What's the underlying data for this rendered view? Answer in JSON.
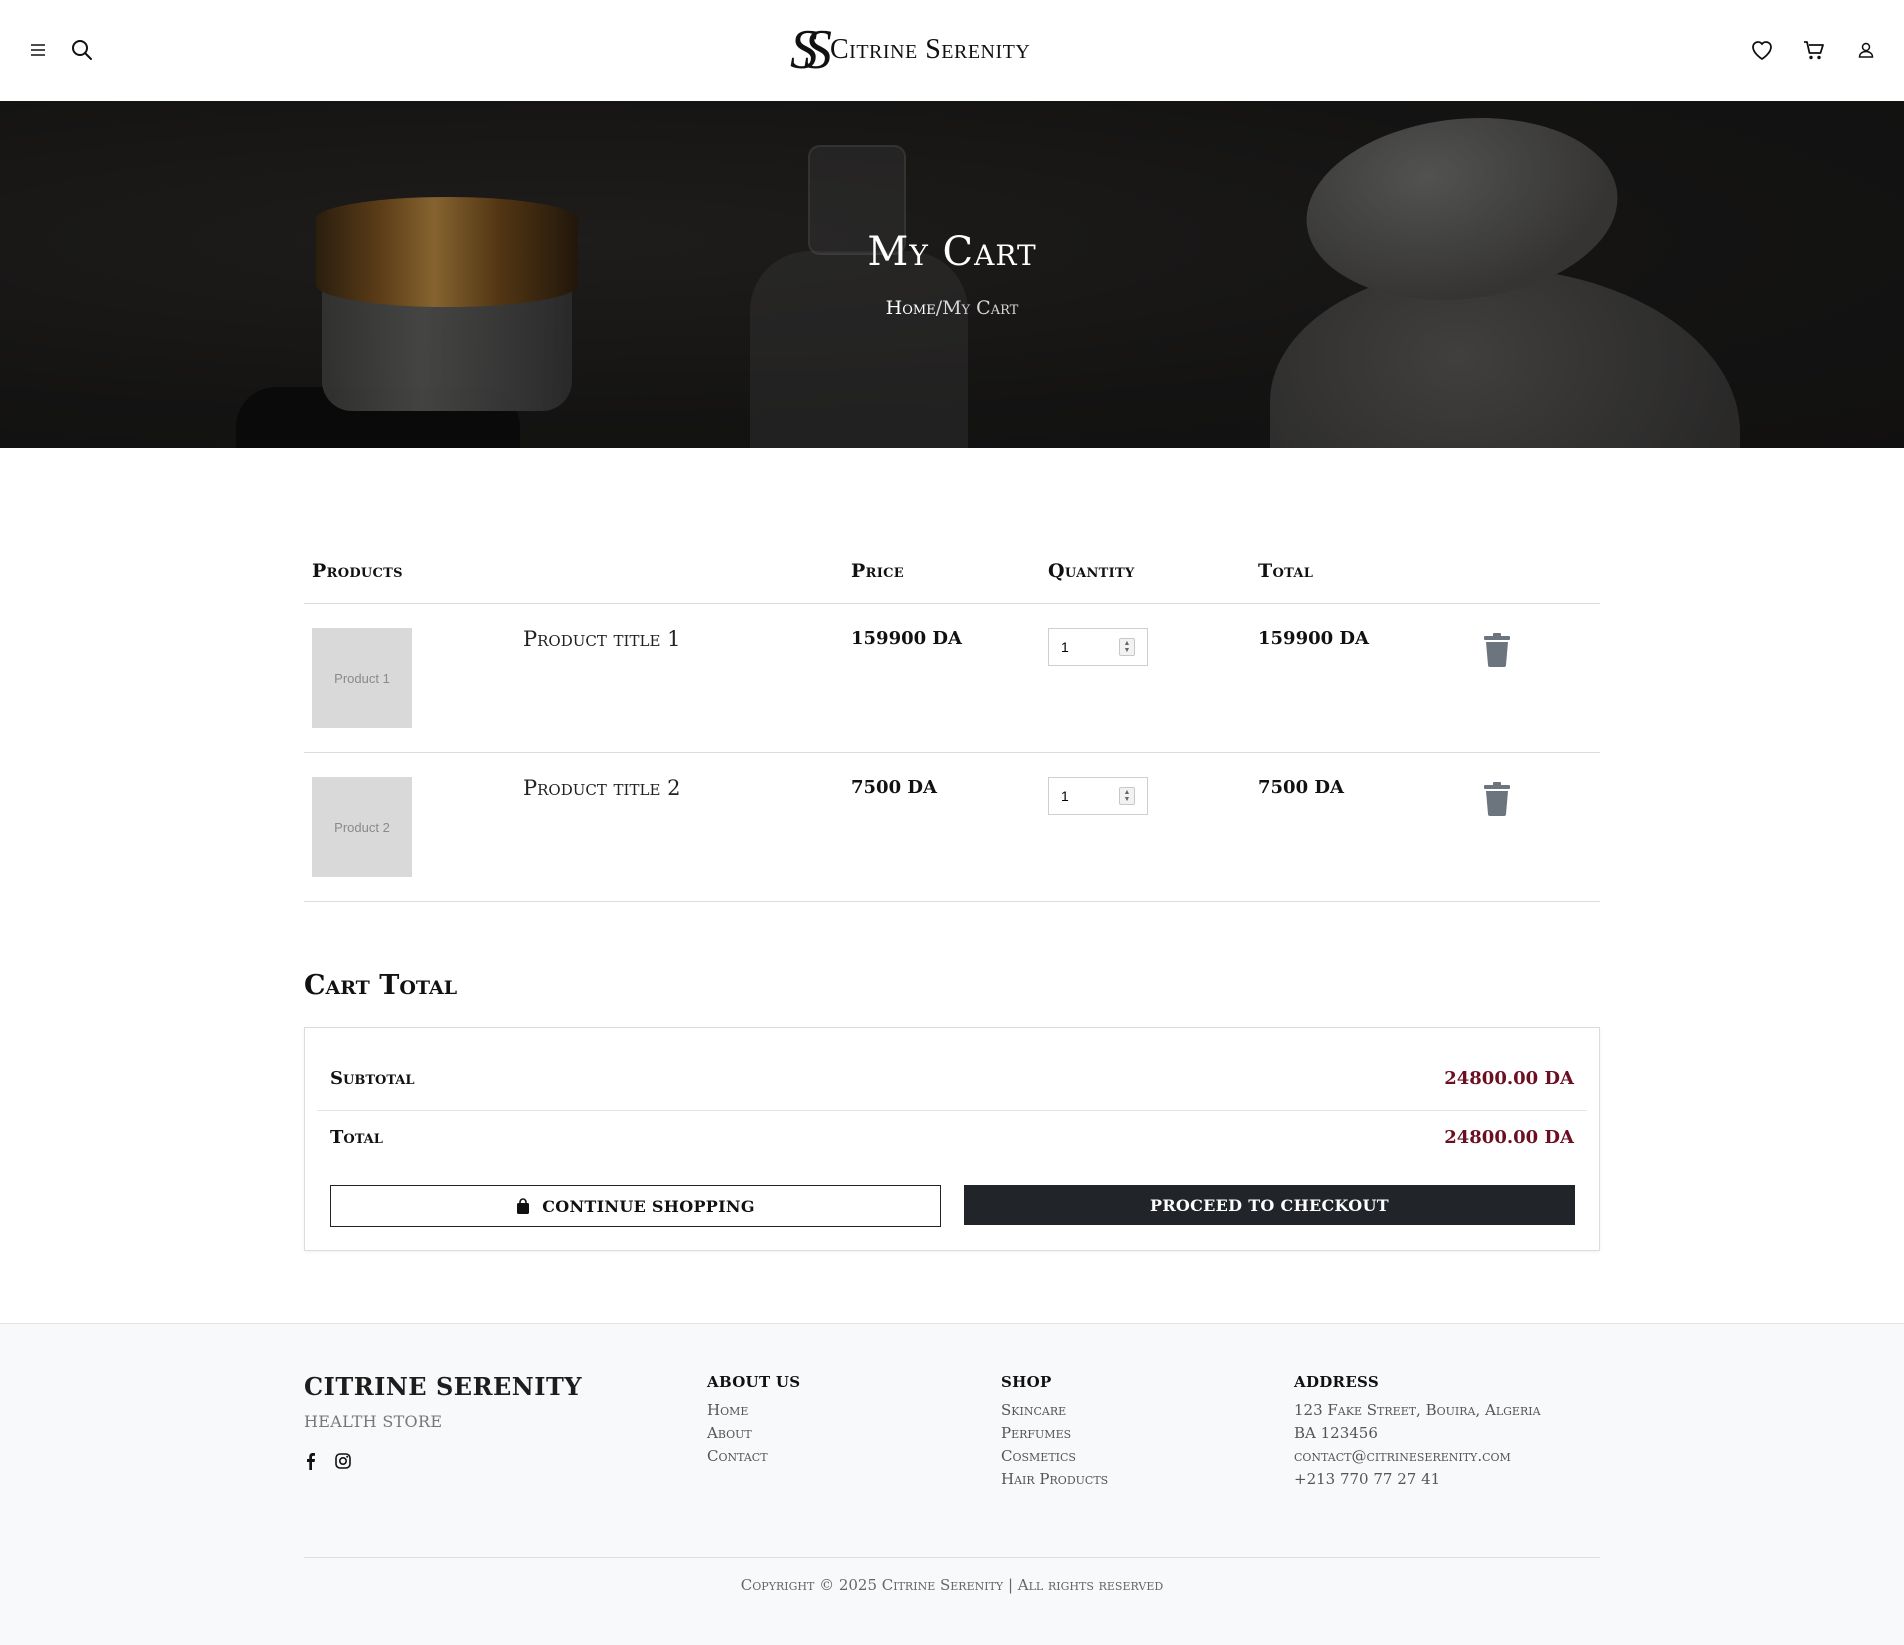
{
  "header": {
    "brand_mark": "SS",
    "brand_name": "Citrine Serenity"
  },
  "hero": {
    "title": "My Cart",
    "breadcrumb": {
      "home": "Home",
      "separator": "/",
      "current": "My Cart"
    }
  },
  "cart": {
    "headers": {
      "products": "Products",
      "price": "Price",
      "quantity": "Quantity",
      "total": "Total"
    },
    "items": [
      {
        "image_label": "Product 1",
        "title": "Product title 1",
        "price": "159900 DA",
        "quantity": "1",
        "total": "159900 DA"
      },
      {
        "image_label": "Product 2",
        "title": "Product title 2",
        "price": "7500 DA",
        "quantity": "1",
        "total": "7500 DA"
      }
    ]
  },
  "cart_total": {
    "title": "Cart Total",
    "subtotal_label": "Subtotal",
    "subtotal_value": "24800.00 DA",
    "total_label": "Total",
    "total_value": "24800.00 DA",
    "continue_label": "CONTINUE SHOPPING",
    "checkout_label": "PROCEED TO CHECKOUT"
  },
  "footer": {
    "brand": "CITRINE SERENITY",
    "tagline": "HEALTH STORE",
    "about": {
      "heading": "ABOUT US",
      "links": [
        "Home",
        "About",
        "Contact"
      ]
    },
    "shop": {
      "heading": "SHOP",
      "links": [
        "Skincare",
        "Perfumes",
        "Cosmetics",
        "Hair Products"
      ]
    },
    "address": {
      "heading": "ADDRESS",
      "lines": [
        "123 Fake Street, Bouira, Algeria",
        "BA 123456",
        "contact@citrineserenity.com",
        "+213 770 77 27 41"
      ]
    },
    "copyright": "Copyright © 2025 Citrine Serenity | All rights reserved"
  },
  "colors": {
    "accent": "#6b0f22",
    "dark_button": "#212529",
    "footer_bg": "#f8f9fa"
  },
  "icons": [
    "menu-icon",
    "search-icon",
    "heart-icon",
    "cart-icon",
    "user-icon",
    "trash-icon",
    "shopping-bag-icon",
    "facebook-icon",
    "instagram-icon"
  ]
}
